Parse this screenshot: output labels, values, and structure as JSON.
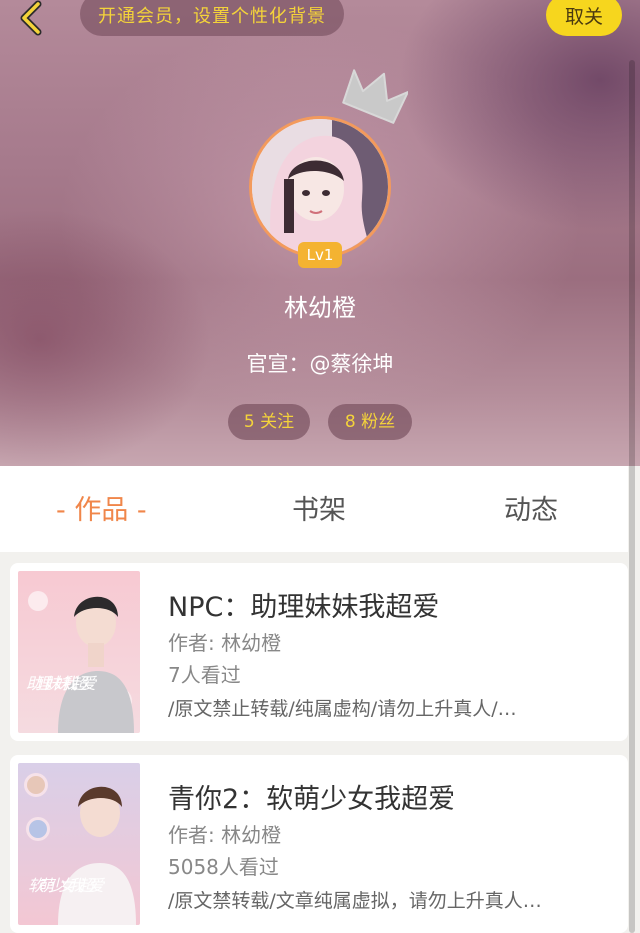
{
  "header": {
    "vip_banner": "开通会员，设置个性化背景",
    "unfollow_label": "取关",
    "level": "Lv1",
    "username": "林幼橙",
    "bio": "官宣：@蔡徐坤",
    "following": "5 关注",
    "followers": "8 粉丝"
  },
  "tabs": [
    "- 作品 -",
    "书架",
    "动态"
  ],
  "works": [
    {
      "title": "NPC：助理妹妹我超爱",
      "author": "作者: 林幼橙",
      "views": "7人看过",
      "tags": "/原文禁止转载/纯属虚构/请勿上升真人/…",
      "cover_text": "助理妹妹 我超爱"
    },
    {
      "title": "青你2：软萌少女我超爱",
      "author": "作者: 林幼橙",
      "views": "5058人看过",
      "tags": "/原文禁转载/文章纯属虚拟，请勿上升真人…",
      "cover_text": "软萌少女 我超爱"
    }
  ],
  "colors": {
    "accent_orange": "#f0864a",
    "chip_yellow": "#f4d33a",
    "unfollow_yellow": "#f6d61e",
    "level_badge": "#f4b331"
  },
  "icons": [
    "back-arrow-icon",
    "crown-icon"
  ]
}
